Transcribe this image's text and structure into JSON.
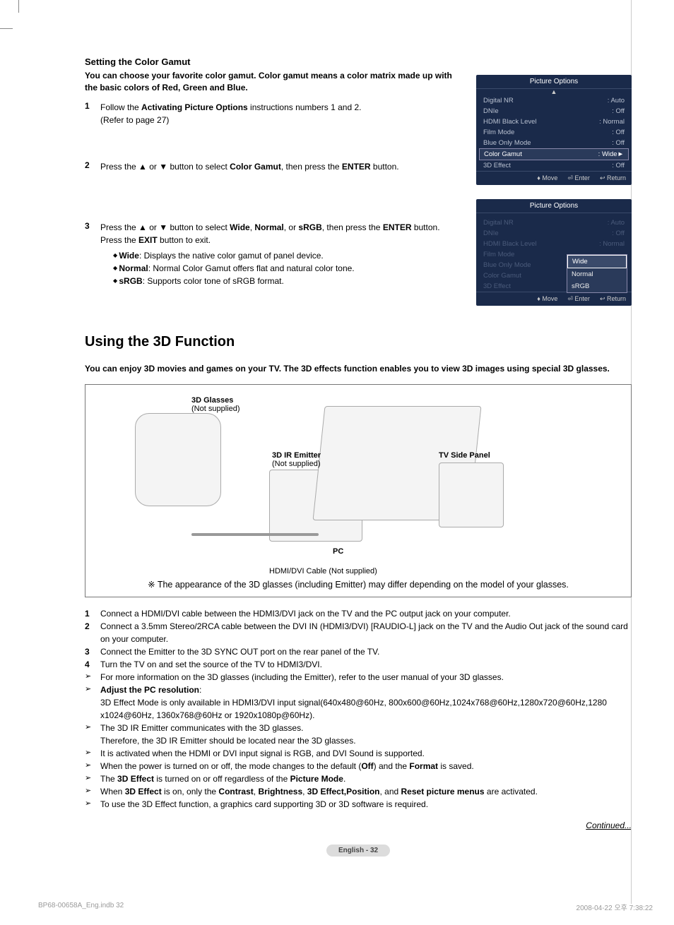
{
  "section1": {
    "title": "Setting the Color Gamut",
    "intro": "You can choose your favorite color gamut. Color gamut means a color matrix made up with the basic colors of Red, Green and Blue.",
    "steps": [
      {
        "num": "1",
        "pre": "Follow the ",
        "bold1": "Activating Picture Options",
        "mid": " instructions numbers 1 and 2.",
        "line2": "(Refer to page 27)"
      },
      {
        "num": "2",
        "pre": "Press the ▲ or ▼ button to select ",
        "bold1": "Color Gamut",
        "mid": ", then press the ",
        "bold2": "ENTER",
        "post": " button."
      },
      {
        "num": "3",
        "pre": "Press the ▲ or ▼ button to select ",
        "bold1": "Wide",
        "sep1": ", ",
        "bold2": "Normal",
        "sep2": ", or ",
        "bold3": "sRGB",
        "mid": ", then press the ",
        "bold4": "ENTER",
        "post": " button.",
        "line2_pre": "Press the ",
        "line2_bold": "EXIT",
        "line2_post": " button to exit."
      }
    ],
    "bullets": [
      {
        "bold": "Wide",
        "text": ": Displays the native color gamut of panel device."
      },
      {
        "bold": "Normal",
        "text": ": Normal Color Gamut offers flat and natural color tone."
      },
      {
        "bold": "sRGB",
        "text": ": Supports color tone of sRGB format."
      }
    ]
  },
  "osd1": {
    "header": "Picture Options",
    "rows": [
      {
        "lbl": "Digital NR",
        "val": "Auto"
      },
      {
        "lbl": "DNIe",
        "val": "Off"
      },
      {
        "lbl": "HDMI Black Level",
        "val": "Normal"
      },
      {
        "lbl": "Film Mode",
        "val": "Off"
      },
      {
        "lbl": "Blue Only Mode",
        "val": "Off"
      },
      {
        "lbl": "Color Gamut",
        "val": "Wide",
        "highlight": true,
        "arrow": "►"
      },
      {
        "lbl": "3D Effect",
        "val": "Off"
      }
    ],
    "footer": {
      "move": "Move",
      "enter": "Enter",
      "return": "Return"
    }
  },
  "osd2": {
    "header": "Picture Options",
    "rows": [
      {
        "lbl": "Digital NR",
        "val": "Auto"
      },
      {
        "lbl": "DNIe",
        "val": "Off"
      },
      {
        "lbl": "HDMI Black Level",
        "val": "Normal"
      },
      {
        "lbl": "Film Mode"
      },
      {
        "lbl": "Blue Only Mode"
      },
      {
        "lbl": "Color Gamut"
      },
      {
        "lbl": "3D Effect"
      }
    ],
    "dropdown": [
      "Wide",
      "Normal",
      "sRGB"
    ],
    "footer": {
      "move": "Move",
      "enter": "Enter",
      "return": "Return"
    }
  },
  "section2": {
    "h1": "Using the 3D Function",
    "intro": "You can enjoy 3D movies and games on your TV. The 3D effects function enables you to view 3D images using special 3D glasses.",
    "diag": {
      "glasses": "3D Glasses",
      "glasses_sub": "(Not supplied)",
      "emitter": "3D IR Emitter",
      "emitter_sub": "(Not supplied)",
      "sidepanel": "TV Side Panel",
      "pc": "PC",
      "cable": "HDMI/DVI Cable (Not supplied)",
      "note": "The appearance of the 3D glasses (including Emitter) may differ depending on the model of your glasses."
    },
    "list": [
      {
        "type": "num",
        "n": "1",
        "text": "Connect a HDMI/DVI cable between the HDMI3/DVI jack on the TV and the PC output jack on your computer."
      },
      {
        "type": "num",
        "n": "2",
        "text": "Connect a 3.5mm Stereo/2RCA cable between the DVI IN (HDMI3/DVI) [RAUDIO-L] jack on the TV and the Audio Out jack of the sound card on your computer."
      },
      {
        "type": "num",
        "n": "3",
        "text": "Connect the Emitter to the 3D SYNC OUT port on the rear panel of the TV."
      },
      {
        "type": "num",
        "n": "4",
        "text": "Turn the TV on and set the source of the TV to HDMI3/DVI."
      },
      {
        "type": "arrow",
        "text": "For more information on the 3D glasses (including the Emitter), refer to the user manual of your 3D glasses."
      },
      {
        "type": "arrow",
        "bold": "Adjust the PC resolution",
        "text": ":"
      },
      {
        "type": "indent",
        "text": "3D Effect Mode is only available in HDMI3/DVI input signal(640x480@60Hz, 800x600@60Hz,1024x768@60Hz,1280x720@60Hz,1280 x1024@60Hz, 1360x768@60Hz or 1920x1080p@60Hz)."
      },
      {
        "type": "arrow",
        "text": "The 3D IR Emitter communicates with the 3D glasses."
      },
      {
        "type": "indent",
        "text": "Therefore, the 3D IR Emitter should be located near the 3D glasses."
      },
      {
        "type": "arrow",
        "text": "It is activated when the HDMI or DVI input signal is RGB, and DVI Sound is supported."
      },
      {
        "type": "arrow",
        "pre": "When the power is turned on or off, the mode changes to the default (",
        "bold": "Off",
        "mid": ") and the ",
        "bold2": "Format",
        "post": " is saved."
      },
      {
        "type": "arrow",
        "pre": "The ",
        "bold": "3D Effect",
        "mid": " is turned on or off regardless of the ",
        "bold2": "Picture Mode",
        "post": "."
      },
      {
        "type": "arrow",
        "pre": "When ",
        "bold": "3D Effect",
        "mid": " is on, only the ",
        "bold2": "Contrast",
        "sep": ", ",
        "bold3": "Brightness",
        "sep2": ", ",
        "bold4": "3D Effect,Position",
        "sep3": ", and ",
        "bold5": "Reset picture menus",
        "post": " are activated."
      },
      {
        "type": "arrow",
        "text": "To use the 3D Effect function, a graphics card supporting 3D or 3D software is required."
      }
    ],
    "continued": "Continued..."
  },
  "pagefoot": {
    "badge": "English - 32",
    "left": "BP68-00658A_Eng.indb   32",
    "right": "2008-04-22   오후 7:38:22"
  }
}
